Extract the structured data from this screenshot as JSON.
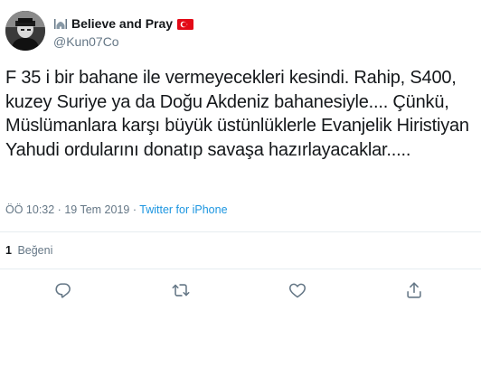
{
  "user": {
    "display_name": "Believe and Pray",
    "handle": "@Kun07Co",
    "name_icons": [
      "mosque-emoji",
      "turkey-flag-emoji"
    ]
  },
  "tweet": {
    "text": "F 35 i bir bahane ile vermeyecekleri kesindi. Rahip, S400, kuzey Suriye ya da Doğu Akdeniz bahanesiyle.... Çünkü, Müslümanlara karşı büyük üstünlüklerle Evanjelik Hiristiyan Yahudi ordularını donatıp savaşa hazırlayacaklar.....",
    "time": "ÖÖ 10:32",
    "separator": " · ",
    "date": "19 Tem 2019",
    "source": "Twitter for iPhone"
  },
  "stats": {
    "likes_count": "1",
    "likes_label": "Beğeni"
  },
  "actions": {
    "icons": [
      "reply-icon",
      "retweet-icon",
      "like-icon",
      "share-icon"
    ]
  },
  "colors": {
    "text": "#14171a",
    "secondary": "#657786",
    "link": "#1b95e0",
    "divider": "#e6ecf0",
    "flag_red": "#e30a17"
  }
}
